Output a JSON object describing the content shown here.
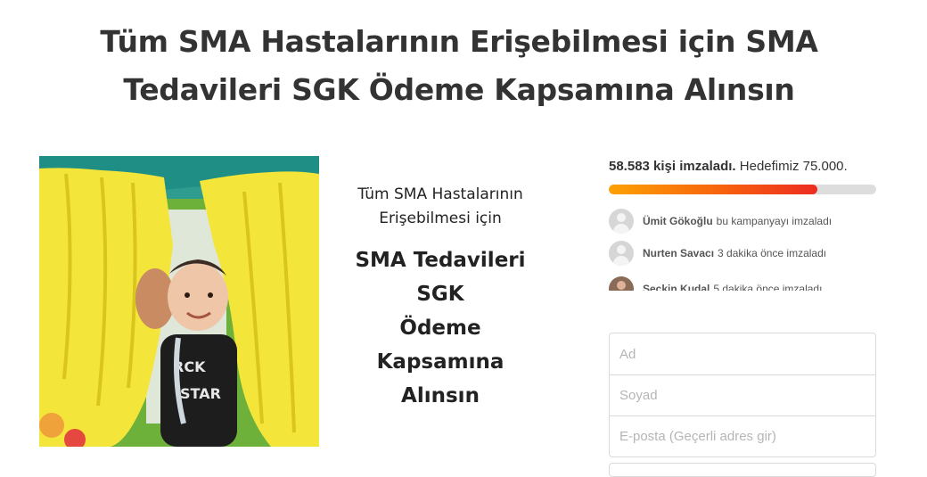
{
  "page": {
    "title": "Tüm SMA Hastalarının Erişebilmesi için SMA Tedavileri SGK Ödeme Kapsamına Alınsın"
  },
  "media": {
    "poster_lines": [
      "Tüm SMA Hastalarının",
      "Erişebilmesi için"
    ],
    "poster_bold_lines": [
      "SMA Tedavileri",
      "SGK",
      "Ödeme",
      "Kapsamına",
      "Alınsın"
    ]
  },
  "stats": {
    "signed": "58.583 kişi imzaladı.",
    "goal": "Hedefimiz 75.000.",
    "progress_fraction": 0.781
  },
  "signers": [
    {
      "name": "Ümit Gökoğlu",
      "action": "bu kampanyayı imzaladı",
      "avatar": "default-avatar"
    },
    {
      "name": "Nurten Savacı",
      "action": "3 dakika önce imzaladı",
      "avatar": "default-avatar"
    },
    {
      "name": "Seçkin Kudal",
      "action": "5 dakika önce imzaladı",
      "avatar": "photo-avatar"
    }
  ],
  "form": {
    "first_name_placeholder": "Ad",
    "last_name_placeholder": "Soyad",
    "email_placeholder": "E-posta (Geçerli adres gir)"
  },
  "colors": {
    "progress_start": "#fca104",
    "progress_end": "#ec2c22",
    "progress_track": "#dddddd"
  }
}
